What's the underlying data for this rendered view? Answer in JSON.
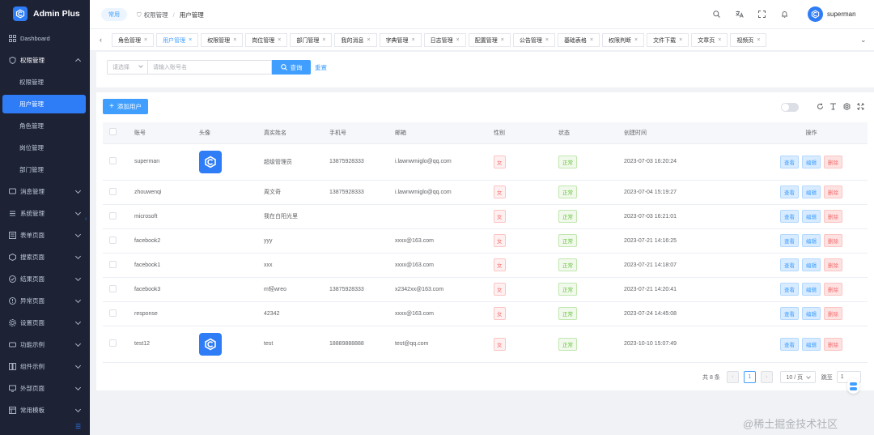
{
  "app": {
    "title": "Admin Plus"
  },
  "sidebar": {
    "items": [
      {
        "label": "Dashboard",
        "icon": "grid-icon"
      },
      {
        "label": "权限管理",
        "icon": "shield-icon",
        "open": true
      },
      {
        "label": "消息管理",
        "icon": "message-icon"
      },
      {
        "label": "系统管理",
        "icon": "settings-icon"
      },
      {
        "label": "表单页面",
        "icon": "form-icon"
      },
      {
        "label": "搜索页面",
        "icon": "search-page-icon"
      },
      {
        "label": "结果页面",
        "icon": "result-icon"
      },
      {
        "label": "异常页面",
        "icon": "warning-icon"
      },
      {
        "label": "设置页面",
        "icon": "setting-page-icon"
      },
      {
        "label": "功能示例",
        "icon": "function-icon"
      },
      {
        "label": "组件示例",
        "icon": "component-icon"
      },
      {
        "label": "外部页面",
        "icon": "external-icon"
      },
      {
        "label": "常用模板",
        "icon": "template-icon"
      }
    ],
    "submenu": [
      "权限管理",
      "用户管理",
      "角色管理",
      "岗位管理",
      "部门管理"
    ]
  },
  "header": {
    "home": "常用",
    "breadcrumb": [
      "权限管理",
      "用户管理"
    ],
    "user": "superman"
  },
  "tags": [
    {
      "label": "角色管理",
      "active": false
    },
    {
      "label": "用户管理",
      "active": true
    },
    {
      "label": "权限管理",
      "active": false
    },
    {
      "label": "岗位管理",
      "active": false
    },
    {
      "label": "部门管理",
      "active": false
    },
    {
      "label": "我的消息",
      "active": false
    },
    {
      "label": "字典管理",
      "active": false
    },
    {
      "label": "日志管理",
      "active": false
    },
    {
      "label": "配置管理",
      "active": false
    },
    {
      "label": "公告管理",
      "active": false
    },
    {
      "label": "基础表格",
      "active": false
    },
    {
      "label": "权限判断",
      "active": false
    },
    {
      "label": "文件下载",
      "active": false
    },
    {
      "label": "文章页",
      "active": false
    },
    {
      "label": "视频页",
      "active": false
    }
  ],
  "search": {
    "select_placeholder": "请选择",
    "input_placeholder": "请输入账号名",
    "button": "查询",
    "reset": "重置"
  },
  "toolbar": {
    "add_user": "添加用户"
  },
  "table": {
    "columns": [
      "账号",
      "头像",
      "真实姓名",
      "手机号",
      "邮箱",
      "性别",
      "状态",
      "创建时间",
      "操作"
    ],
    "actions": [
      "查看",
      "编辑",
      "删除"
    ],
    "rows": [
      {
        "account": "superman",
        "avatar": true,
        "name": "超级管理员",
        "phone": "13875928333",
        "email": "i.lawnwmiglo@qq.com",
        "gender": "女",
        "status": "正常",
        "created": "2023-07-03 16:20:24"
      },
      {
        "account": "zhouwenqi",
        "avatar": false,
        "name": "周文奇",
        "phone": "13875928333",
        "email": "i.lawnwmiglo@qq.com",
        "gender": "女",
        "status": "正常",
        "created": "2023-07-04 15:19:27"
      },
      {
        "account": "microsoft",
        "avatar": false,
        "name": "我在白阳光里",
        "phone": "",
        "email": "",
        "gender": "女",
        "status": "正常",
        "created": "2023-07-03 16:21:01"
      },
      {
        "account": "facebook2",
        "avatar": false,
        "name": "yyy",
        "phone": "",
        "email": "xxxx@163.com",
        "gender": "女",
        "status": "正常",
        "created": "2023-07-21 14:16:25"
      },
      {
        "account": "facebook1",
        "avatar": false,
        "name": "xxx",
        "phone": "",
        "email": "xxxx@163.com",
        "gender": "女",
        "status": "正常",
        "created": "2023-07-21 14:18:07"
      },
      {
        "account": "facebook3",
        "avatar": false,
        "name": "m轻wreo",
        "phone": "13875928333",
        "email": "x2342xx@163.com",
        "gender": "女",
        "status": "正常",
        "created": "2023-07-21 14:20:41"
      },
      {
        "account": "response",
        "avatar": false,
        "name": "42342",
        "phone": "",
        "email": "xxxx@163.com",
        "gender": "女",
        "status": "正常",
        "created": "2023-07-24 14:45:08"
      },
      {
        "account": "test12",
        "avatar": true,
        "name": "test",
        "phone": "18889888888",
        "email": "test@qq.com",
        "gender": "女",
        "status": "正常",
        "created": "2023-10-10 15:07:49"
      }
    ]
  },
  "pagination": {
    "total": "共 8 条",
    "current": "1",
    "page_size": "10 / 页",
    "jump_label": "跳至",
    "jump_value": "1"
  },
  "watermark": "@稀土掘金技术社区",
  "colors": {
    "primary": "#409eff",
    "sidebar_bg": "#1d2235",
    "danger": "#f56c6c",
    "success": "#67c23a"
  }
}
